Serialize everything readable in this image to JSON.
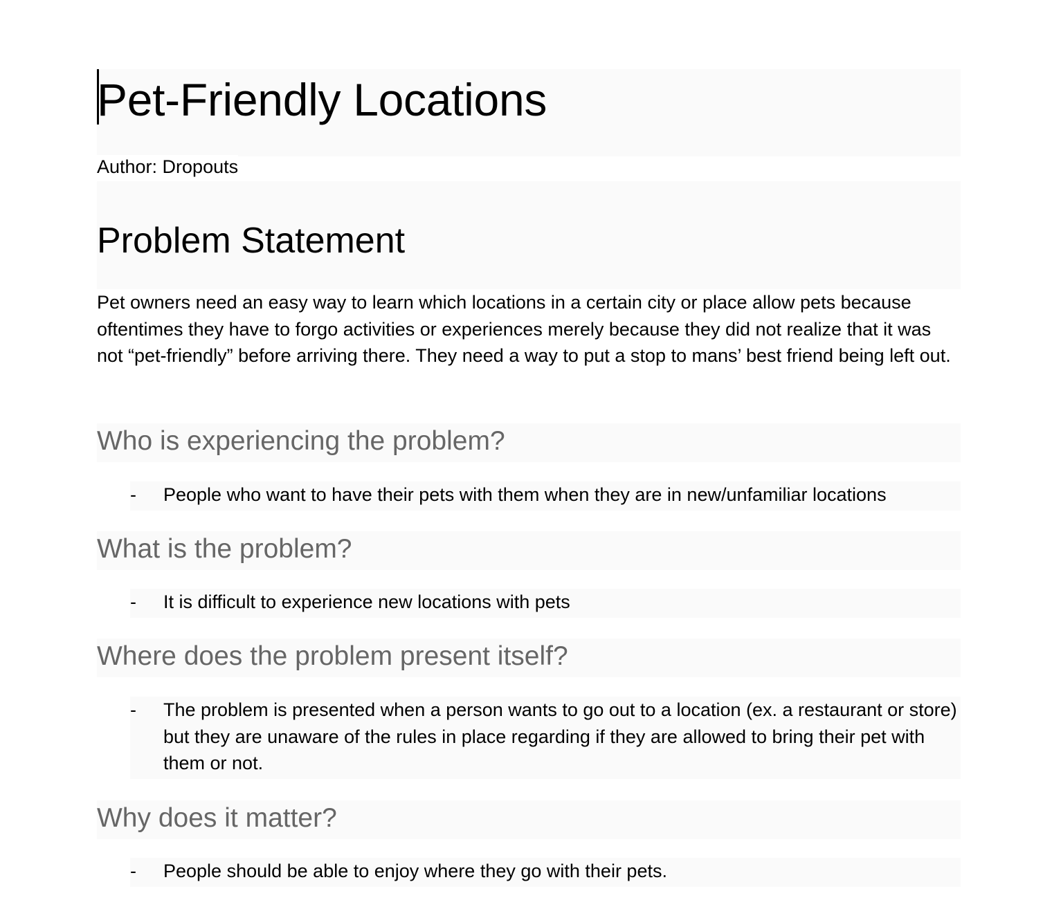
{
  "document": {
    "title": "Pet-Friendly Locations",
    "author": "Author: Dropouts",
    "problem_heading": "Problem Statement",
    "problem_text": "Pet owners need an easy way to learn which locations in a certain city or place allow pets because oftentimes they have to forgo activities or experiences merely because they did not realize that it was not “pet-friendly” before arriving there. They need a way to put a stop to mans’ best friend being left out.",
    "sections": [
      {
        "heading": "Who is experiencing the problem?",
        "bullet_marker": "-",
        "bullet": "People who want to have their pets with them when they are in new/unfamiliar locations"
      },
      {
        "heading": "What is the problem?",
        "bullet_marker": "-",
        "bullet": "It is difficult to experience new locations with pets"
      },
      {
        "heading": "Where does the problem present itself?",
        "bullet_marker": "-",
        "bullet": "The problem is presented when a person wants to go out to a location (ex. a restaurant or store) but they are unaware of the rules in place regarding if they are allowed to bring their pet with them or not."
      },
      {
        "heading": "Why does it matter?",
        "bullet_marker": "-",
        "bullet": "People should be able to enjoy where they go with their pets."
      }
    ]
  }
}
